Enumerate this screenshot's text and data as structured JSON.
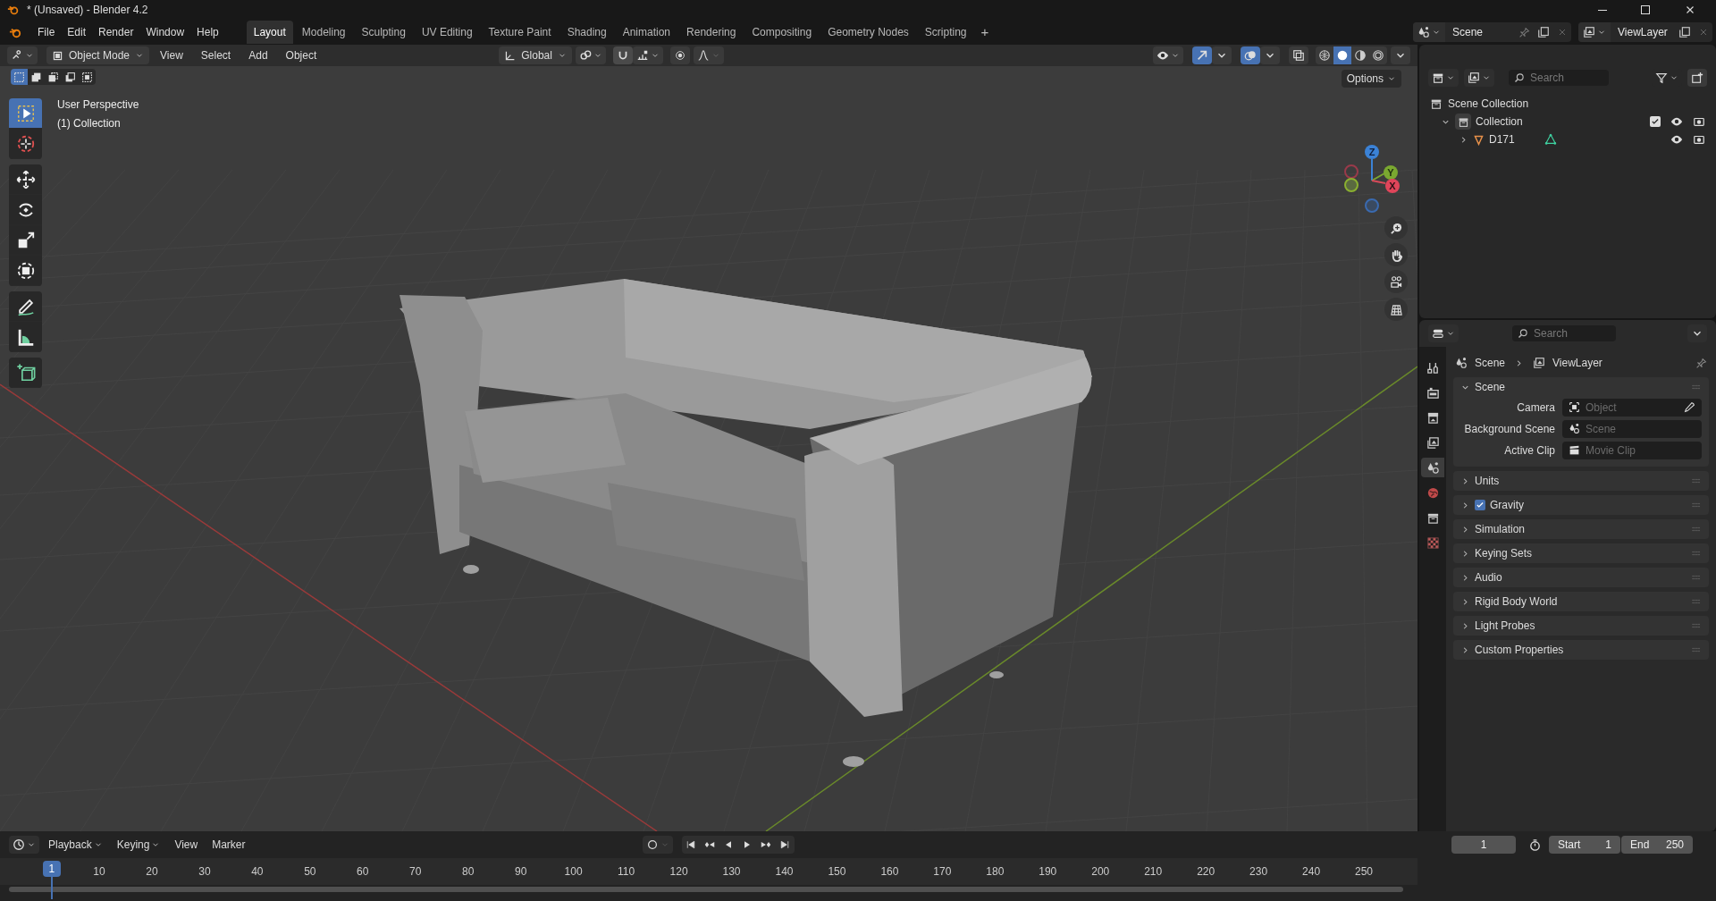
{
  "window": {
    "title": "* (Unsaved) - Blender 4.2"
  },
  "menu": [
    "File",
    "Edit",
    "Render",
    "Window",
    "Help"
  ],
  "workspaces": [
    {
      "label": "Layout",
      "selected": true
    },
    {
      "label": "Modeling",
      "selected": false
    },
    {
      "label": "Sculpting",
      "selected": false
    },
    {
      "label": "UV Editing",
      "selected": false
    },
    {
      "label": "Texture Paint",
      "selected": false
    },
    {
      "label": "Shading",
      "selected": false
    },
    {
      "label": "Animation",
      "selected": false
    },
    {
      "label": "Rendering",
      "selected": false
    },
    {
      "label": "Compositing",
      "selected": false
    },
    {
      "label": "Geometry Nodes",
      "selected": false
    },
    {
      "label": "Scripting",
      "selected": false
    }
  ],
  "add_workspace": "+",
  "scene_selector": {
    "scene": "Scene",
    "view_layer": "ViewLayer"
  },
  "viewport": {
    "mode": "Object Mode",
    "menus": [
      "View",
      "Select",
      "Add",
      "Object"
    ],
    "orientation": "Global",
    "options": "Options",
    "overlay_text": [
      "User Perspective",
      "(1) Collection"
    ],
    "select_modes": [
      {
        "kind": "set",
        "selected": true
      },
      {
        "kind": "extend",
        "selected": false
      },
      {
        "kind": "subtract",
        "selected": false
      },
      {
        "kind": "invert",
        "selected": false
      },
      {
        "kind": "intersect",
        "selected": false
      }
    ],
    "tool_groups": [
      [
        {
          "kind": "select",
          "selected": true
        },
        {
          "kind": "cursor",
          "selected": false
        }
      ],
      [
        {
          "kind": "move",
          "selected": false
        },
        {
          "kind": "rotate",
          "selected": false
        },
        {
          "kind": "scale",
          "selected": false
        },
        {
          "kind": "transform",
          "selected": false
        }
      ],
      [
        {
          "kind": "annotate",
          "selected": false
        },
        {
          "kind": "measure",
          "selected": false
        }
      ],
      [
        {
          "kind": "add-cube",
          "selected": false
        }
      ]
    ],
    "shading": [
      {
        "kind": "wireframe",
        "selected": false
      },
      {
        "kind": "solid",
        "selected": true
      },
      {
        "kind": "material",
        "selected": false
      },
      {
        "kind": "rendered",
        "selected": false
      }
    ],
    "gizmo": {
      "z": "Z",
      "y": "Y",
      "x": "X"
    }
  },
  "outliner": {
    "search_placeholder": "Search",
    "root": "Scene Collection",
    "children": [
      {
        "label": "Collection",
        "expanded": true,
        "checked": true,
        "children": [
          {
            "label": "D171",
            "expanded": false
          }
        ]
      }
    ]
  },
  "properties": {
    "search_placeholder": "Search",
    "breadcrumb": [
      "Scene",
      "ViewLayer"
    ],
    "tabs": [
      {
        "kind": "tool",
        "selected": false
      },
      {
        "kind": "render",
        "selected": false
      },
      {
        "kind": "output",
        "selected": false
      },
      {
        "kind": "view-layer",
        "selected": false
      },
      {
        "kind": "scene",
        "selected": true
      },
      {
        "kind": "world",
        "selected": false
      },
      {
        "kind": "collection",
        "selected": false
      },
      {
        "kind": "texture",
        "selected": false
      }
    ],
    "panels": [
      {
        "kind": "plain",
        "title": "Scene",
        "expanded": true,
        "fields": [
          {
            "kind": "object",
            "label": "Camera",
            "placeholder": "Object"
          },
          {
            "kind": "scene",
            "label": "Background Scene",
            "placeholder": "Scene"
          },
          {
            "kind": "clip",
            "label": "Active Clip",
            "placeholder": "Movie Clip"
          }
        ]
      },
      {
        "kind": "plain",
        "title": "Units",
        "expanded": false
      },
      {
        "kind": "toggle",
        "title": "Gravity",
        "expanded": false,
        "checked": true
      },
      {
        "kind": "plain",
        "title": "Simulation",
        "expanded": false
      },
      {
        "kind": "plain",
        "title": "Keying Sets",
        "expanded": false
      },
      {
        "kind": "plain",
        "title": "Audio",
        "expanded": false
      },
      {
        "kind": "plain",
        "title": "Rigid Body World",
        "expanded": false
      },
      {
        "kind": "plain",
        "title": "Light Probes",
        "expanded": false
      },
      {
        "kind": "plain",
        "title": "Custom Properties",
        "expanded": false
      }
    ]
  },
  "timeline": {
    "menus": [
      "Playback",
      "Keying",
      "View",
      "Marker"
    ],
    "auto_keying": false,
    "current_frame": "1",
    "start": {
      "label": "Start",
      "value": "1"
    },
    "end": {
      "label": "End",
      "value": "250"
    },
    "playhead": "1",
    "ticks": [
      "10",
      "20",
      "30",
      "40",
      "50",
      "60",
      "70",
      "80",
      "90",
      "100",
      "110",
      "120",
      "130",
      "140",
      "150",
      "160",
      "170",
      "180",
      "190",
      "200",
      "210",
      "220",
      "230",
      "240",
      "250"
    ]
  }
}
